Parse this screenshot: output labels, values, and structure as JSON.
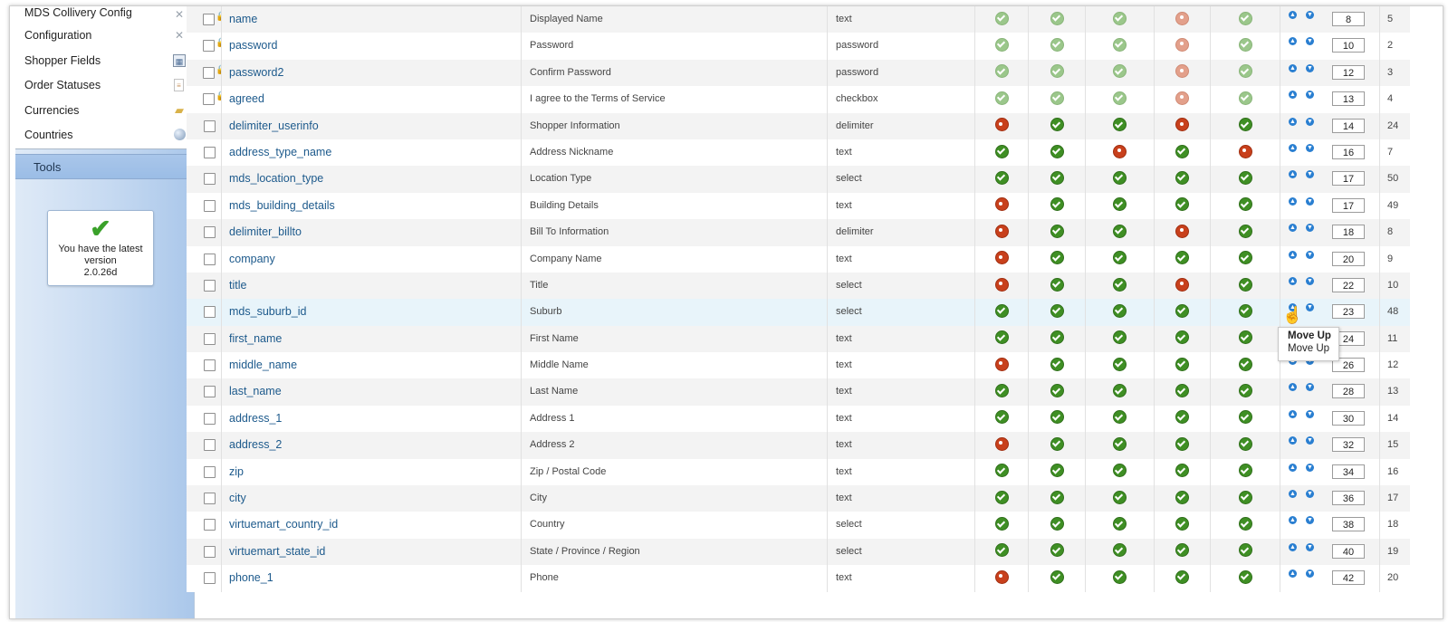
{
  "sidebar": {
    "menu": [
      {
        "label": "MDS Collivery Config",
        "icon": "tools-icon"
      },
      {
        "label": "Configuration",
        "icon": "tools-icon"
      },
      {
        "label": "Shopper Fields",
        "icon": "fields-icon"
      },
      {
        "label": "Order Statuses",
        "icon": "document-icon"
      },
      {
        "label": "Currencies",
        "icon": "coins-icon"
      },
      {
        "label": "Countries",
        "icon": "globe-icon"
      }
    ],
    "tools_label": "Tools",
    "version": {
      "line1": "You have the latest",
      "line2": "version",
      "line3": "2.0.26d"
    }
  },
  "rows": [
    {
      "name": "name",
      "title": "Displayed Name",
      "type": "text",
      "locked": true,
      "states": [
        "fy",
        "fy",
        "fy",
        "fn",
        "fy"
      ],
      "ordering": "8",
      "id": "5"
    },
    {
      "name": "password",
      "title": "Password",
      "type": "password",
      "locked": true,
      "states": [
        "fy",
        "fy",
        "fy",
        "fn",
        "fy"
      ],
      "ordering": "10",
      "id": "2"
    },
    {
      "name": "password2",
      "title": "Confirm Password",
      "type": "password",
      "locked": true,
      "states": [
        "fy",
        "fy",
        "fy",
        "fn",
        "fy"
      ],
      "ordering": "12",
      "id": "3"
    },
    {
      "name": "agreed",
      "title": "I agree to the Terms of Service",
      "type": "checkbox",
      "locked": true,
      "states": [
        "fy",
        "fy",
        "fy",
        "fn",
        "fy"
      ],
      "ordering": "13",
      "id": "4"
    },
    {
      "name": "delimiter_userinfo",
      "title": "Shopper Information",
      "type": "delimiter",
      "locked": false,
      "states": [
        "n",
        "y",
        "y",
        "n",
        "y"
      ],
      "ordering": "14",
      "id": "24"
    },
    {
      "name": "address_type_name",
      "title": "Address Nickname",
      "type": "text",
      "locked": false,
      "states": [
        "y",
        "y",
        "n",
        "y",
        "n"
      ],
      "ordering": "16",
      "id": "7"
    },
    {
      "name": "mds_location_type",
      "title": "Location Type",
      "type": "select",
      "locked": false,
      "states": [
        "y",
        "y",
        "y",
        "y",
        "y"
      ],
      "ordering": "17",
      "id": "50"
    },
    {
      "name": "mds_building_details",
      "title": "Building Details",
      "type": "text",
      "locked": false,
      "states": [
        "n",
        "y",
        "y",
        "y",
        "y"
      ],
      "ordering": "17",
      "id": "49"
    },
    {
      "name": "delimiter_billto",
      "title": "Bill To Information",
      "type": "delimiter",
      "locked": false,
      "states": [
        "n",
        "y",
        "y",
        "n",
        "y"
      ],
      "ordering": "18",
      "id": "8"
    },
    {
      "name": "company",
      "title": "Company Name",
      "type": "text",
      "locked": false,
      "states": [
        "n",
        "y",
        "y",
        "y",
        "y"
      ],
      "ordering": "20",
      "id": "9"
    },
    {
      "name": "title",
      "title": "Title",
      "type": "select",
      "locked": false,
      "states": [
        "n",
        "y",
        "y",
        "n",
        "y"
      ],
      "ordering": "22",
      "id": "10"
    },
    {
      "name": "mds_suburb_id",
      "title": "Suburb",
      "type": "select",
      "locked": false,
      "states": [
        "y",
        "y",
        "y",
        "y",
        "y"
      ],
      "ordering": "23",
      "id": "48"
    },
    {
      "name": "first_name",
      "title": "First Name",
      "type": "text",
      "locked": false,
      "states": [
        "y",
        "y",
        "y",
        "y",
        "y"
      ],
      "ordering": "24",
      "id": "11"
    },
    {
      "name": "middle_name",
      "title": "Middle Name",
      "type": "text",
      "locked": false,
      "states": [
        "n",
        "y",
        "y",
        "y",
        "y"
      ],
      "ordering": "26",
      "id": "12"
    },
    {
      "name": "last_name",
      "title": "Last Name",
      "type": "text",
      "locked": false,
      "states": [
        "y",
        "y",
        "y",
        "y",
        "y"
      ],
      "ordering": "28",
      "id": "13"
    },
    {
      "name": "address_1",
      "title": "Address 1",
      "type": "text",
      "locked": false,
      "states": [
        "y",
        "y",
        "y",
        "y",
        "y"
      ],
      "ordering": "30",
      "id": "14"
    },
    {
      "name": "address_2",
      "title": "Address 2",
      "type": "text",
      "locked": false,
      "states": [
        "n",
        "y",
        "y",
        "y",
        "y"
      ],
      "ordering": "32",
      "id": "15"
    },
    {
      "name": "zip",
      "title": "Zip / Postal Code",
      "type": "text",
      "locked": false,
      "states": [
        "y",
        "y",
        "y",
        "y",
        "y"
      ],
      "ordering": "34",
      "id": "16"
    },
    {
      "name": "city",
      "title": "City",
      "type": "text",
      "locked": false,
      "states": [
        "y",
        "y",
        "y",
        "y",
        "y"
      ],
      "ordering": "36",
      "id": "17"
    },
    {
      "name": "virtuemart_country_id",
      "title": "Country",
      "type": "select",
      "locked": false,
      "states": [
        "y",
        "y",
        "y",
        "y",
        "y"
      ],
      "ordering": "38",
      "id": "18"
    },
    {
      "name": "virtuemart_state_id",
      "title": "State / Province / Region",
      "type": "select",
      "locked": false,
      "states": [
        "y",
        "y",
        "y",
        "y",
        "y"
      ],
      "ordering": "40",
      "id": "19"
    },
    {
      "name": "phone_1",
      "title": "Phone",
      "type": "text",
      "locked": false,
      "states": [
        "n",
        "y",
        "y",
        "y",
        "y"
      ],
      "ordering": "42",
      "id": "20"
    }
  ],
  "tooltip": {
    "title": "Move Up",
    "text": "Move Up"
  }
}
